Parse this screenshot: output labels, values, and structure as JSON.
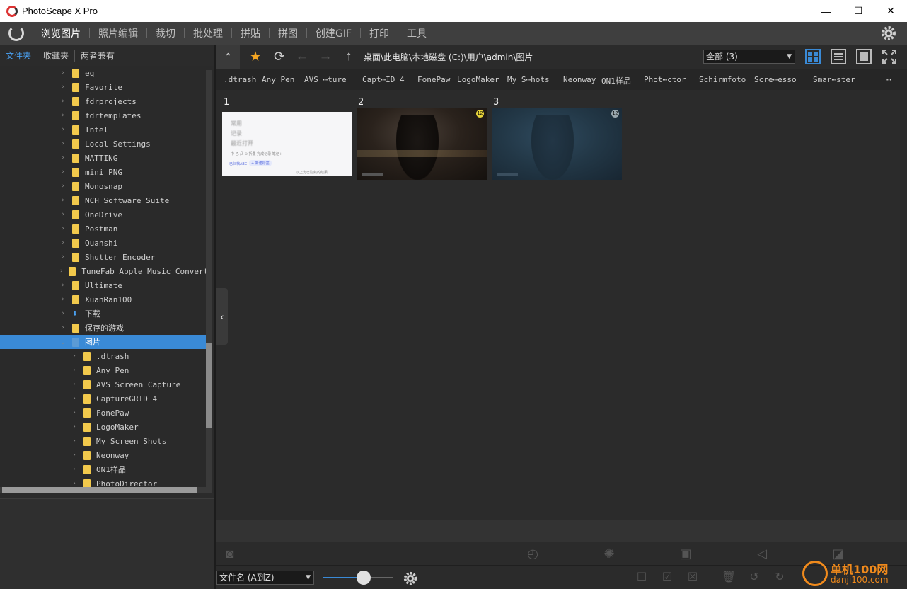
{
  "window": {
    "title": "PhotoScape X Pro",
    "minimize": "—",
    "maximize": "☐",
    "close": "✕"
  },
  "menu": {
    "items": [
      {
        "label": "浏览图片",
        "active": true
      },
      {
        "label": "照片编辑"
      },
      {
        "label": "裁切"
      },
      {
        "label": "批处理"
      },
      {
        "label": "拼贴"
      },
      {
        "label": "拼图"
      },
      {
        "label": "创建GIF"
      },
      {
        "label": "打印"
      },
      {
        "label": "工具"
      }
    ]
  },
  "left_tabs": [
    "文件夹",
    "收藏夹",
    "两者兼有"
  ],
  "tree": {
    "items": [
      {
        "label": "eq"
      },
      {
        "label": "Favorite"
      },
      {
        "label": "fdrprojects"
      },
      {
        "label": "fdrtemplates"
      },
      {
        "label": "Intel"
      },
      {
        "label": "Local Settings"
      },
      {
        "label": "MATTING"
      },
      {
        "label": "mini PNG"
      },
      {
        "label": "Monosnap"
      },
      {
        "label": "NCH Software Suite"
      },
      {
        "label": "OneDrive"
      },
      {
        "label": "Postman"
      },
      {
        "label": "Quanshi"
      },
      {
        "label": "Shutter Encoder"
      },
      {
        "label": "TuneFab Apple Music Converter"
      },
      {
        "label": "Ultimate"
      },
      {
        "label": "XuanRan100"
      },
      {
        "label": "下载"
      },
      {
        "label": "保存的游戏"
      },
      {
        "label": "图片",
        "selected": true
      },
      {
        "label": ".dtrash",
        "child": true
      },
      {
        "label": "Any Pen",
        "child": true
      },
      {
        "label": "AVS Screen Capture",
        "child": true
      },
      {
        "label": "CaptureGRID 4",
        "child": true
      },
      {
        "label": "FonePaw",
        "child": true
      },
      {
        "label": "LogoMaker",
        "child": true
      },
      {
        "label": "My Screen Shots",
        "child": true
      },
      {
        "label": "Neonway",
        "child": true
      },
      {
        "label": "ON1样品",
        "child": true
      },
      {
        "label": "PhotoDirector",
        "child": true
      }
    ]
  },
  "nav": {
    "path": "桌面\\此电脑\\本地磁盘 (C:)\\用户\\admin\\图片",
    "filter": "全部 (3)"
  },
  "favorites": [
    ".dtrash",
    "Any Pen",
    "AVS ⋯ture",
    "Capt⋯ID 4",
    "FonePaw",
    "LogoMaker",
    "My S⋯hots",
    "Neonway",
    "ON1样品",
    "Phot⋯ctor",
    "Schirmfoto",
    "Scre⋯esso",
    "Smar⋯ster",
    "⋯"
  ],
  "thumbnails": [
    {
      "num": "1",
      "lines": [
        "常用",
        "记录",
        "最近打开"
      ],
      "actions": "中  乙  凸  ⊙    折叠   完成记录   笔记+",
      "tags": [
        "已归档ABC",
        "+ 新建标签"
      ],
      "footer": "以上为已隐藏的结果"
    },
    {
      "num": "2",
      "badge": "12"
    },
    {
      "num": "3",
      "badge": "12"
    }
  ],
  "bottom": {
    "sort": "文件名 (A到Z)",
    "zoom_level": 0.58
  },
  "watermark": {
    "line1": "单机100网",
    "line2": "danji100.com"
  }
}
